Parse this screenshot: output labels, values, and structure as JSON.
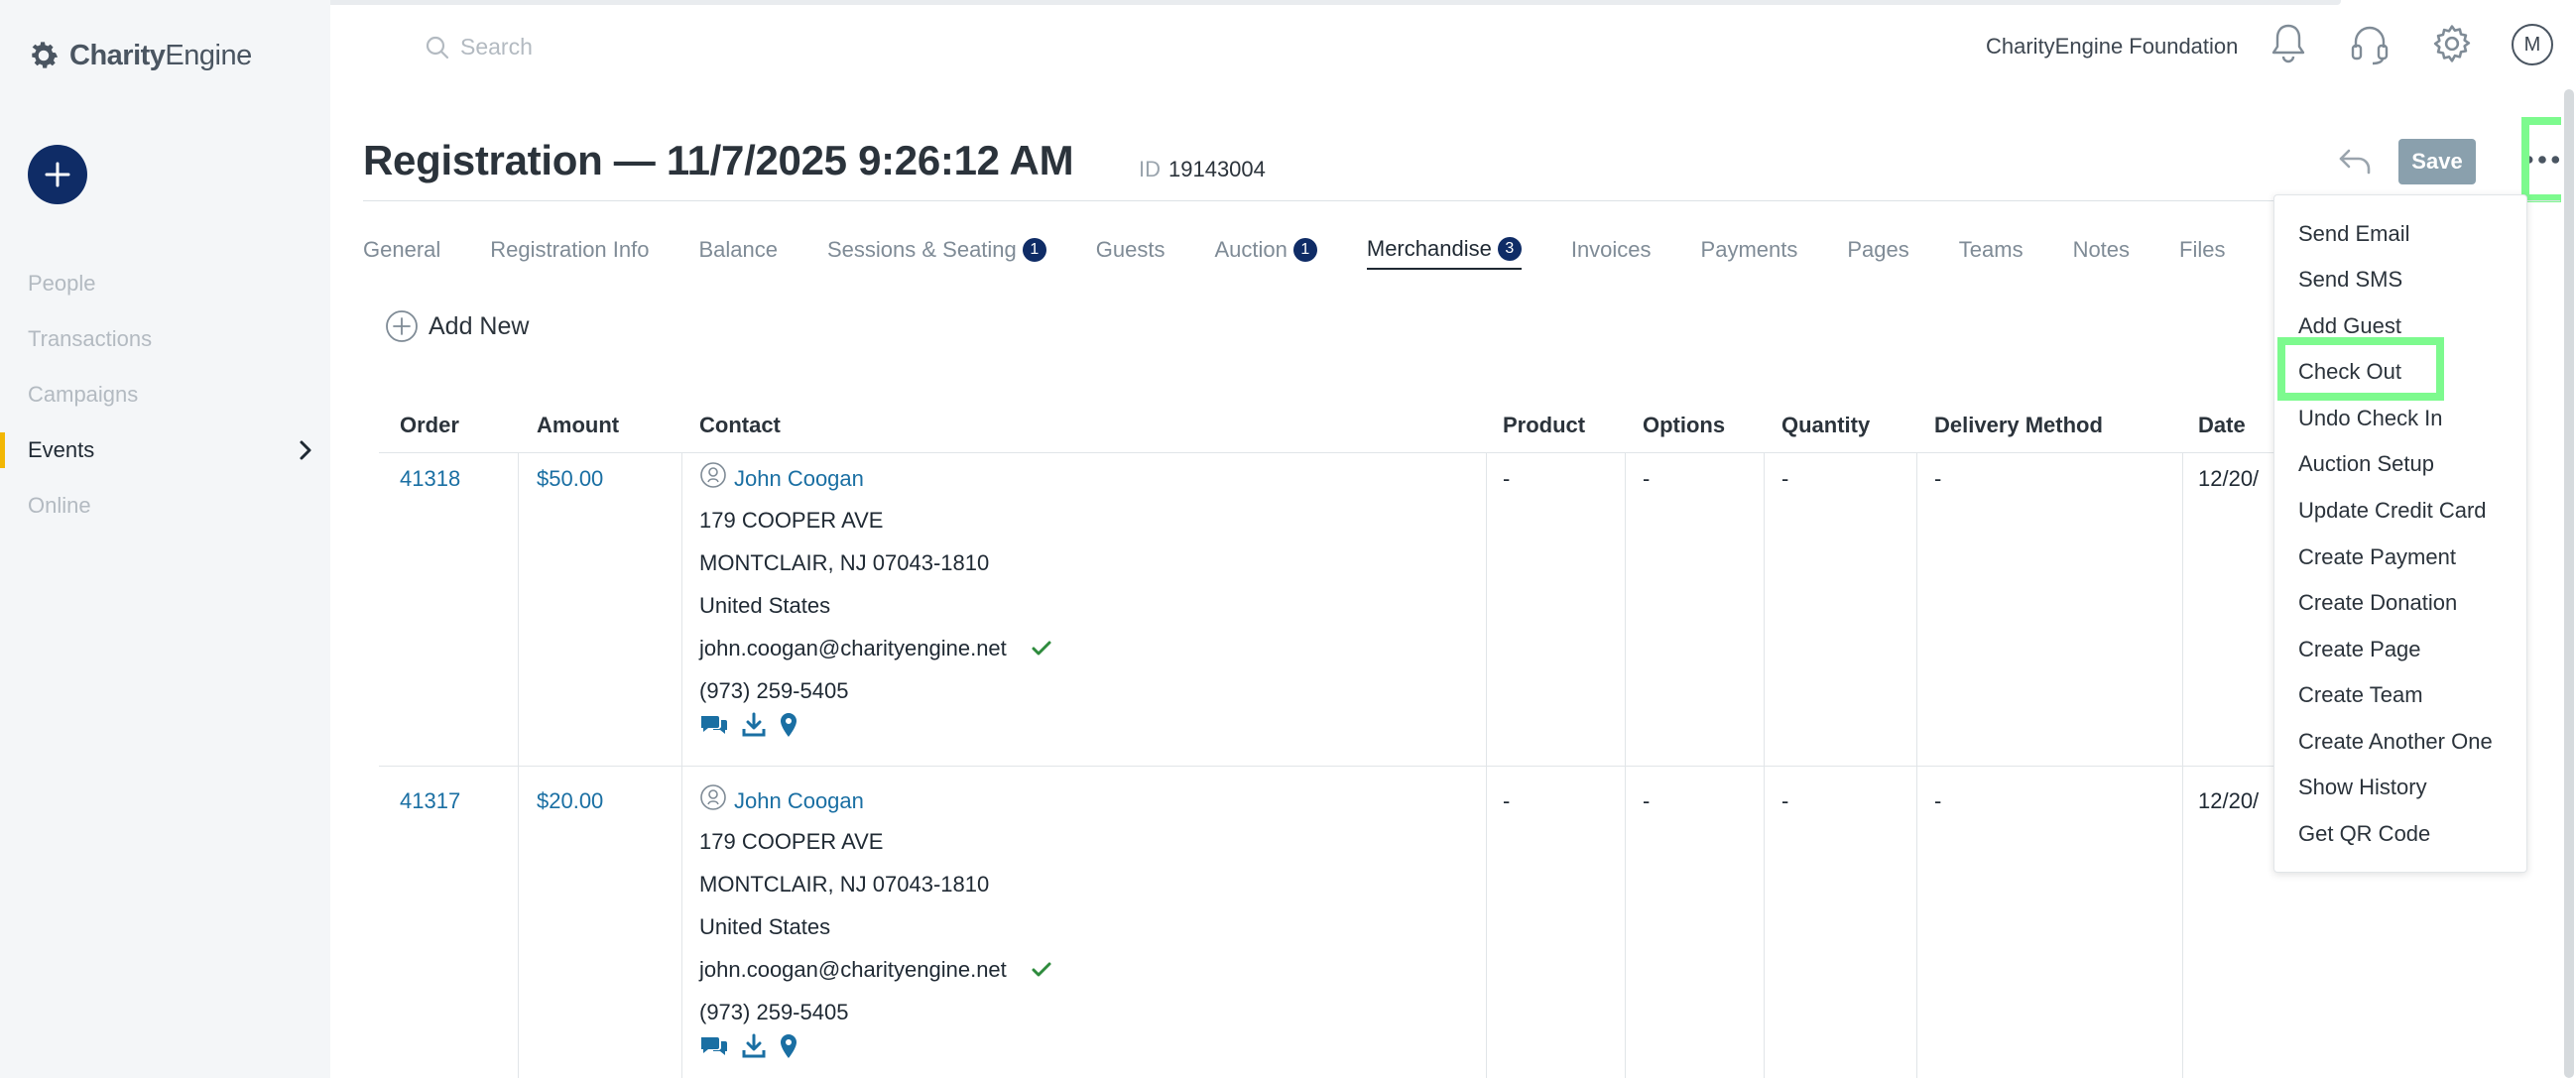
{
  "app": {
    "logo_bold": "Charity",
    "logo_light": "Engine"
  },
  "header": {
    "search_placeholder": "Search",
    "org_name": "CharityEngine Foundation",
    "avatar_initial": "M"
  },
  "sidebar": {
    "items": [
      {
        "label": "People"
      },
      {
        "label": "Transactions"
      },
      {
        "label": "Campaigns"
      },
      {
        "label": "Events"
      },
      {
        "label": "Online"
      }
    ]
  },
  "record": {
    "title": "Registration — 11/7/2025 9:26:12 AM",
    "id_label": "ID",
    "id_value": "19143004",
    "save_label": "Save"
  },
  "tabs": [
    {
      "label": "General"
    },
    {
      "label": "Registration Info"
    },
    {
      "label": "Balance"
    },
    {
      "label": "Sessions & Seating",
      "badge": "1"
    },
    {
      "label": "Guests"
    },
    {
      "label": "Auction",
      "badge": "1"
    },
    {
      "label": "Merchandise",
      "badge": "3"
    },
    {
      "label": "Invoices"
    },
    {
      "label": "Payments"
    },
    {
      "label": "Pages"
    },
    {
      "label": "Teams"
    },
    {
      "label": "Notes"
    },
    {
      "label": "Files"
    }
  ],
  "toolbar": {
    "add_new_label": "Add New"
  },
  "table": {
    "headers": [
      "Order",
      "Amount",
      "Contact",
      "Product",
      "Options",
      "Quantity",
      "Delivery Method",
      "Date"
    ],
    "rows": [
      {
        "order": "41318",
        "amount": "$50.00",
        "name": "John Coogan",
        "street": "179 COOPER AVE",
        "city": "MONTCLAIR, NJ 07043-1810",
        "country": "United States",
        "email": "john.coogan@charityengine.net",
        "phone": "(973) 259-5405",
        "product": "-",
        "options": "-",
        "quantity": "-",
        "delivery": "-",
        "date": "12/20/"
      },
      {
        "order": "41317",
        "amount": "$20.00",
        "name": "John Coogan",
        "street": "179 COOPER AVE",
        "city": "MONTCLAIR, NJ 07043-1810",
        "country": "United States",
        "email": "john.coogan@charityengine.net",
        "phone": "(973) 259-5405",
        "product": "-",
        "options": "-",
        "quantity": "-",
        "delivery": "-",
        "date": "12/20/"
      }
    ]
  },
  "menu": {
    "items": [
      {
        "label": "Send Email"
      },
      {
        "label": "Send SMS"
      },
      {
        "label": "Add Guest"
      },
      {
        "label": "Check Out"
      },
      {
        "label": "Undo Check In"
      },
      {
        "label": "Auction Setup"
      },
      {
        "label": "Update Credit Card"
      },
      {
        "label": "Create Payment"
      },
      {
        "label": "Create Donation"
      },
      {
        "label": "Create Page"
      },
      {
        "label": "Create Team"
      },
      {
        "label": "Create Another One"
      },
      {
        "label": "Show History"
      },
      {
        "label": "Get QR Code"
      }
    ]
  },
  "colors": {
    "brand_navy": "#0f2c66",
    "link": "#1a6fa3",
    "highlight": "#7dfa8e",
    "active_nav_marker": "#f2b705",
    "verified_check": "#2e8b3d"
  }
}
